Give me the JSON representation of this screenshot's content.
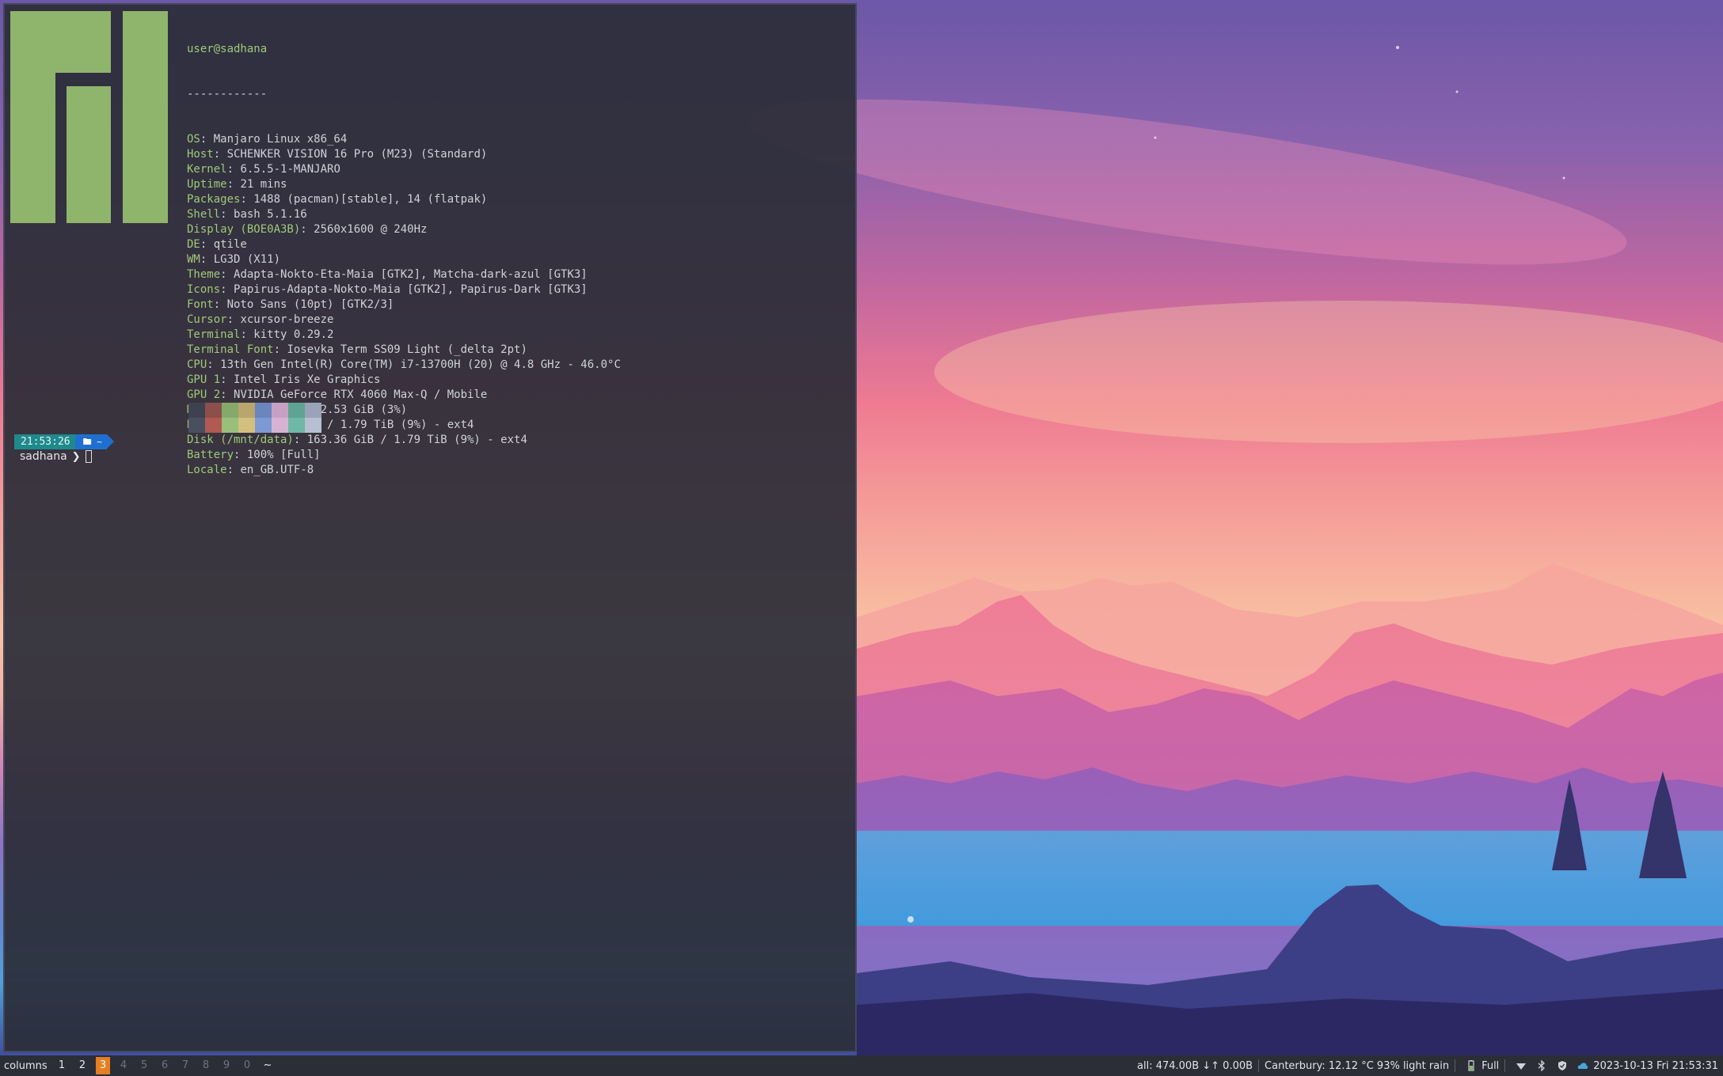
{
  "terminal": {
    "user_host": "user@sadhana",
    "separator": "------------",
    "info": [
      {
        "key": "OS",
        "value": "Manjaro Linux x86_64"
      },
      {
        "key": "Host",
        "value": "SCHENKER VISION 16 Pro (M23) (Standard)"
      },
      {
        "key": "Kernel",
        "value": "6.5.5-1-MANJARO"
      },
      {
        "key": "Uptime",
        "value": "21 mins"
      },
      {
        "key": "Packages",
        "value": "1488 (pacman)[stable], 14 (flatpak)"
      },
      {
        "key": "Shell",
        "value": "bash 5.1.16"
      },
      {
        "key": "Display (BOE0A3B)",
        "value": "2560x1600 @ 240Hz"
      },
      {
        "key": "DE",
        "value": "qtile"
      },
      {
        "key": "WM",
        "value": "LG3D (X11)"
      },
      {
        "key": "Theme",
        "value": "Adapta-Nokto-Eta-Maia [GTK2], Matcha-dark-azul [GTK3]"
      },
      {
        "key": "Icons",
        "value": "Papirus-Adapta-Nokto-Maia [GTK2], Papirus-Dark [GTK3]"
      },
      {
        "key": "Font",
        "value": "Noto Sans (10pt) [GTK2/3]"
      },
      {
        "key": "Cursor",
        "value": "xcursor-breeze"
      },
      {
        "key": "Terminal",
        "value": "kitty 0.29.2"
      },
      {
        "key": "Terminal Font",
        "value": "Iosevka Term SS09 Light (_delta 2pt)"
      },
      {
        "key": "CPU",
        "value": "13th Gen Intel(R) Core(TM) i7-13700H (20) @ 4.8 GHz - 46.0°C"
      },
      {
        "key": "GPU 1",
        "value": "Intel Iris Xe Graphics"
      },
      {
        "key": "GPU 2",
        "value": "NVIDIA GeForce RTX 4060 Max-Q / Mobile"
      },
      {
        "key": "Memory",
        "value": "1.96 GiB / 62.53 GiB (3%)"
      },
      {
        "key": "Disk (/)",
        "value": "166.97 GiB / 1.79 TiB (9%) - ext4"
      },
      {
        "key": "Disk (/mnt/data)",
        "value": "163.36 GiB / 1.79 TiB (9%) - ext4"
      },
      {
        "key": "Battery",
        "value": "100% [Full]"
      },
      {
        "key": "Locale",
        "value": "en_GB.UTF-8"
      }
    ],
    "palette_top": [
      "#3d4150",
      "#8c4f4a",
      "#86a96a",
      "#b8a66e",
      "#6a86bd",
      "#c7a1c4",
      "#5fa392",
      "#9aa3b9"
    ],
    "palette_bottom": [
      "#4a4f60",
      "#b05a52",
      "#98c07a",
      "#d3c07e",
      "#7d99d4",
      "#d6b3d3",
      "#6fb8a6",
      "#b7bfd2"
    ],
    "logo_color": "#8fb46c",
    "prompt": {
      "time": "21:53:26",
      "dir": "~",
      "host": "sadhana",
      "arrow": "❯"
    }
  },
  "bar": {
    "layout": "columns",
    "groups": [
      {
        "label": "1",
        "state": "occupied"
      },
      {
        "label": "2",
        "state": "occupied"
      },
      {
        "label": "3",
        "state": "current"
      },
      {
        "label": "4",
        "state": "empty"
      },
      {
        "label": "5",
        "state": "empty"
      },
      {
        "label": "6",
        "state": "empty"
      },
      {
        "label": "7",
        "state": "empty"
      },
      {
        "label": "8",
        "state": "empty"
      },
      {
        "label": "9",
        "state": "empty"
      },
      {
        "label": "0",
        "state": "empty"
      },
      {
        "label": "~",
        "state": "occupied"
      }
    ],
    "net": "all: 474.00B ↓↑ 0.00B",
    "weather": "Canterbury: 12.12 °C 93% light rain",
    "battery": "Full",
    "clock": "2023-10-13 Fri 21:53:31",
    "accent": "#e67e22"
  }
}
